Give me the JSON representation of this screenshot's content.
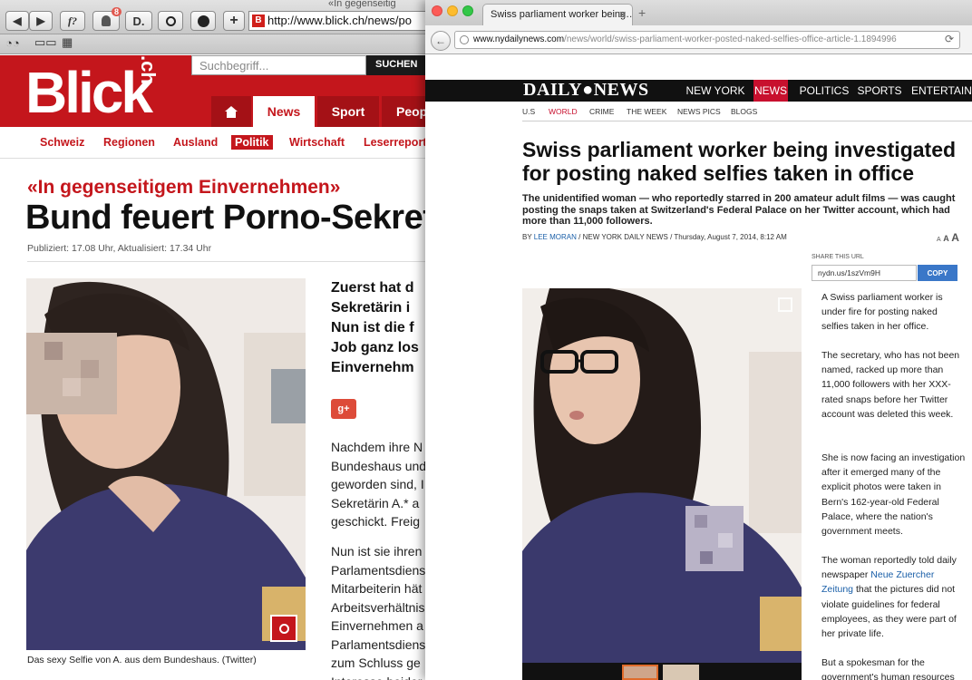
{
  "left_window": {
    "tab_title": "«In gegenseitig",
    "toolbar": {
      "back": "◀",
      "forward": "▶",
      "fq": "f?",
      "ghost_badge": "8",
      "d_btn": "D.",
      "q_btn": "Q",
      "plus": "+",
      "url": "http://www.blick.ch/news/po",
      "url_favicon": "B"
    },
    "bookmarks": {
      "glasses": "👓",
      "book": "📖",
      "grid": "▦"
    },
    "header": {
      "logo": "Blick",
      "logo_suffix": ".ch",
      "search_placeholder": "Suchbegriff...",
      "search_button": "SUCHEN",
      "nav": [
        "News",
        "Sport",
        "Peop"
      ],
      "home_icon": "home-icon"
    },
    "subnav": [
      "Schweiz",
      "Regionen",
      "Ausland",
      "Politik",
      "Wirtschaft",
      "Leserreport"
    ],
    "subnav_active": "Politik",
    "article": {
      "kicker": "«In gegenseitigem Einvernehmen»",
      "headline": "Bund feuert Porno-Sekret",
      "meta": "Publiziert: 17.08 Uhr, Aktualisiert: 17.34 Uhr",
      "caption": "Das sexy Selfie von A. aus dem Bundeshaus. (Twitter)",
      "lead_lines": [
        "Zuerst hat d",
        "Sekretärin i",
        "Nun ist die f",
        "Job ganz los",
        "Einvernehm"
      ],
      "gplus": "g+",
      "body1": [
        "Nachdem ihre N",
        "Bundeshaus und",
        "geworden sind, I",
        "Sekretärin A.* a",
        "geschickt. Freig"
      ],
      "body2": [
        "Nun ist sie ihren",
        "Parlamentsdiens",
        "Mitarbeiterin hät",
        "Arbeitsverhältnis",
        "Einvernehmen a",
        "Parlamentsdiens",
        "zum Schluss ge",
        "Interesse beider"
      ]
    },
    "colors": {
      "brand": "#c4161c"
    }
  },
  "right_window": {
    "tab_title": "Swiss parliament worker being…",
    "tab_close": "✕",
    "url_host": "www.nydailynews.com",
    "url_path": "/news/world/swiss-parliament-worker-posted-naked-selfies-office-article-1.1894996",
    "header": {
      "logo": "DAILY●NEWS",
      "nav": [
        "NEW YORK",
        "NEWS",
        "POLITICS",
        "SPORTS",
        "ENTERTAINMENT"
      ],
      "nav_active": "NEWS"
    },
    "subnav": [
      "U.S",
      "WORLD",
      "CRIME",
      "THE WEEK",
      "NEWS PICS",
      "BLOGS"
    ],
    "subnav_active": "WORLD",
    "article": {
      "headline": "Swiss parliament worker being investigated for posting naked selfies taken in office",
      "dek": "The unidentified woman — who reportedly starred in 200 amateur adult films — was caught posting the snaps taken at Switzerland's Federal Palace on her Twitter account, which had more than 11,000 followers.",
      "by": "BY",
      "author": "LEE MORAN",
      "outlet": "NEW YORK DAILY NEWS",
      "date": "Thursday, August 7, 2014, 8:12 AM",
      "text_size": [
        "A",
        "A",
        "A"
      ],
      "share_label": "SHARE THIS URL",
      "share_url": "nydn.us/1szVm9H",
      "copy": "COPY",
      "paragraphs": [
        "A Swiss parliament worker is under fire for posting naked selfies taken in her office.",
        "The secretary, who has not been named, racked up more than 11,000 followers with her XXX-rated snaps before her Twitter account was deleted this week.",
        "She is now facing an investigation after it emerged many of the explicit photos were taken in Bern's 162-year-old Federal Palace, where the nation's government meets."
      ],
      "p4_before": "The woman reportedly told daily newspaper ",
      "p4_link": "Neue Zuercher Zeitung",
      "p4_after": " that the pictures did not violate guidelines for federal employees, as they were part of her private life.",
      "p5": "But a spokesman for the government's human resources"
    },
    "colors": {
      "brand": "#c8102e",
      "link": "#1a5fa8"
    }
  }
}
